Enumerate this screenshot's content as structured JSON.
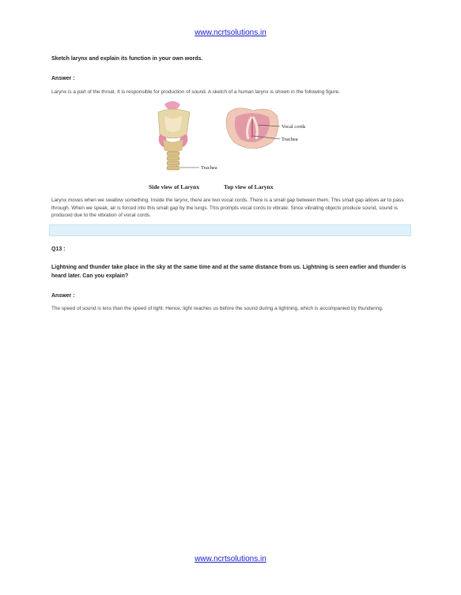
{
  "header": {
    "site_link": "www.ncrtsolutions.in"
  },
  "footer": {
    "site_link": "www.ncrtsolutions.in"
  },
  "q12": {
    "question": "Sketch larynx and explain its function in your own words.",
    "answer_label": "Answer :",
    "answer_intro": "Larynx is a part of the throat. It is responsible for production of sound. A sketch of a human larynx is shown in the following figure.",
    "figure": {
      "label_trachea_side": "Trachea",
      "label_vocal_cords": "Vocal cords",
      "label_trachea_top": "Trachea",
      "caption_side": "Side view of Larynx",
      "caption_top": "Top view of Larynx"
    },
    "answer_explanation": "Larynx moves when we swallow something. Inside the larynx, there are two vocal cords. There is a small gap between them. This small gap allows air to pass through. When we speak, air is forced into this small gap by the lungs. This prompts vocal cords to vibrate. Since vibrating objects produce sound, sound is produced due to the vibration of vocal cords."
  },
  "q13": {
    "number": "Q13 :",
    "question": "Lightning and thunder take place in the sky at the same time and at the same distance from us. Lightning is seen earlier and thunder is heard later. Can you explain?",
    "answer_label": "Answer :",
    "answer": "The speed of sound is less than the speed of light. Hence, light reaches us before the sound during a lightning, which is accompanied by thundering."
  },
  "colors": {
    "link": "#1a1acc",
    "band": "#dff1fa"
  }
}
